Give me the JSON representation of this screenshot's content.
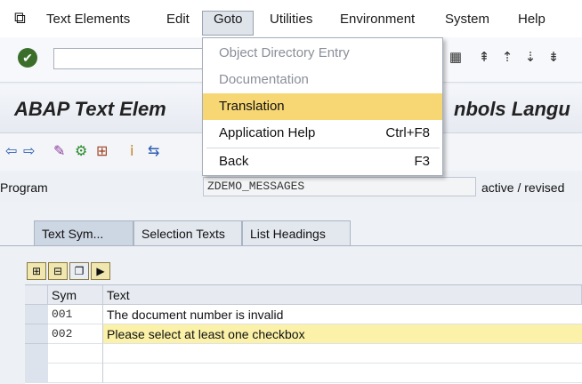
{
  "menubar": {
    "items": [
      {
        "label": "Text Elements"
      },
      {
        "label": "Edit"
      },
      {
        "label": "Goto"
      },
      {
        "label": "Utilities"
      },
      {
        "label": "Environment"
      },
      {
        "label": "System"
      },
      {
        "label": "Help"
      }
    ]
  },
  "goto_menu": {
    "items": [
      {
        "label": "Object Directory Entry",
        "shortcut": "",
        "state": "disabled"
      },
      {
        "label": "Documentation",
        "shortcut": "",
        "state": "disabled"
      },
      {
        "label": "Translation",
        "shortcut": "",
        "state": "highlighted"
      },
      {
        "label": "Application Help",
        "shortcut": "Ctrl+F8",
        "state": "enabled"
      },
      {
        "label": "Back",
        "shortcut": "F3",
        "state": "enabled"
      }
    ]
  },
  "title": {
    "left": "ABAP Text Elem",
    "right": "nbols Langu"
  },
  "program": {
    "label": "Program",
    "value": "ZDEMO_MESSAGES",
    "status": "active / revised"
  },
  "tabs": [
    {
      "label": "Text Sym..."
    },
    {
      "label": "Selection Texts"
    },
    {
      "label": "List Headings"
    }
  ],
  "table": {
    "headers": {
      "sym": "Sym",
      "text": "Text"
    },
    "rows": [
      {
        "sym": "001",
        "text": "The document number is invalid"
      },
      {
        "sym": "002",
        "text": "Please select at least one checkbox"
      }
    ]
  },
  "colors": {
    "highlight": "#f7d774",
    "row_highlight": "#fbf1a8"
  }
}
